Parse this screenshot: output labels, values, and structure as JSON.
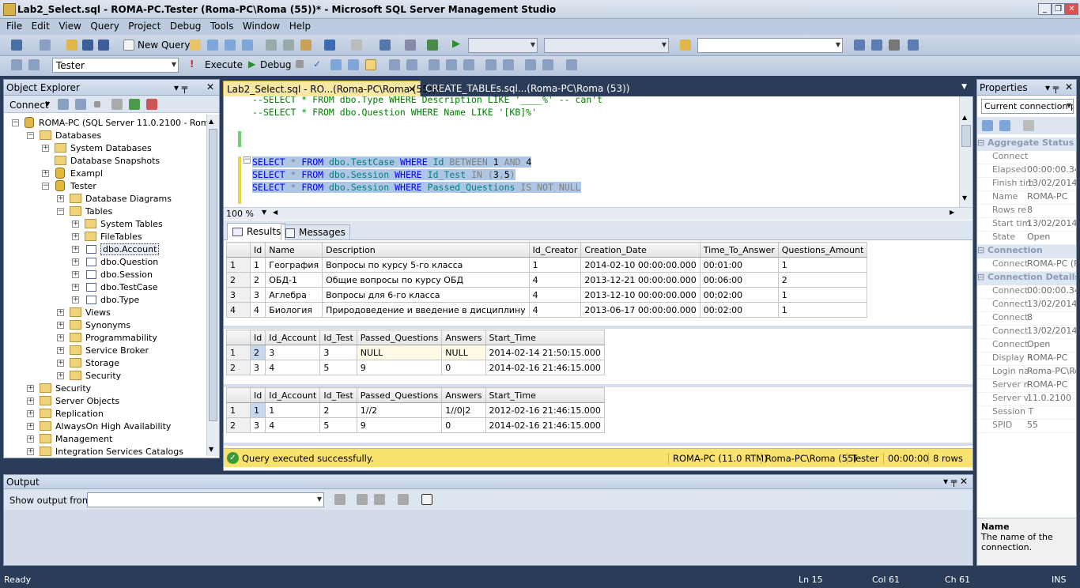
{
  "window": {
    "title": "Lab2_Select.sql - ROMA-PC.Tester (Roma-PC\\Roma (55))* - Microsoft SQL Server Management Studio"
  },
  "menu": [
    "File",
    "Edit",
    "View",
    "Query",
    "Project",
    "Debug",
    "Tools",
    "Window",
    "Help"
  ],
  "toolbar": {
    "new_query": "New Query",
    "database": "Tester",
    "execute": "Execute",
    "debug": "Debug"
  },
  "object_explorer": {
    "title": "Object Explorer",
    "connect": "Connect",
    "nodes": [
      "ROMA-PC (SQL Server 11.0.2100 - Roma-PC\\Roma)",
      "Databases",
      "System Databases",
      "Database Snapshots",
      "Exampl",
      "Tester",
      "Database Diagrams",
      "Tables",
      "System Tables",
      "FileTables",
      "dbo.Account",
      "dbo.Question",
      "dbo.Session",
      "dbo.TestCase",
      "dbo.Type",
      "Views",
      "Synonyms",
      "Programmability",
      "Service Broker",
      "Storage",
      "Security",
      "Security",
      "Server Objects",
      "Replication",
      "AlwaysOn High Availability",
      "Management",
      "Integration Services Catalogs"
    ]
  },
  "tabs": {
    "active": "Lab2_Select.sql - RO...(Roma-PC\\Roma (55))*",
    "other": "CREATE_TABLEs.sql...(Roma-PC\\Roma (53))"
  },
  "editor": {
    "line1": "--SELECT * FROM dbo.Type WHERE Description LIKE '____%' -- can't",
    "line2": "--SELECT * FROM dbo.Question WHERE Name LIKE '[KB]%'",
    "q1": "SELECT * FROM dbo.TestCase WHERE Id BETWEEN 1 AND 4",
    "q2": "SELECT * FROM dbo.Session WHERE Id_Test IN (3,5)",
    "q3": "SELECT * FROM dbo.Session WHERE Passed_Questions IS NOT NULL",
    "zoom": "100 %"
  },
  "results_tabs": {
    "results": "Results",
    "messages": "Messages"
  },
  "grid1": {
    "headers": [
      "Id",
      "Name",
      "Description",
      "Id_Creator",
      "Creation_Date",
      "Time_To_Answer",
      "Questions_Amount"
    ],
    "rows": [
      [
        "1",
        "1",
        "География",
        "Вопросы по курсу 5-го класса",
        "1",
        "2014-02-10 00:00:00.000",
        "00:01:00",
        "1"
      ],
      [
        "2",
        "2",
        "ОБД-1",
        "Общие вопросы по курсу ОБД",
        "4",
        "2013-12-21 00:00:00.000",
        "00:06:00",
        "2"
      ],
      [
        "3",
        "3",
        "Аглебра",
        "Вопросы для 6-го класса",
        "4",
        "2013-12-10 00:00:00.000",
        "00:02:00",
        "1"
      ],
      [
        "4",
        "4",
        "Биология",
        "Природоведение и введение в дисциплину",
        "4",
        "2013-06-17 00:00:00.000",
        "00:02:00",
        "1"
      ]
    ]
  },
  "grid2": {
    "headers": [
      "Id",
      "Id_Account",
      "Id_Test",
      "Passed_Questions",
      "Answers",
      "Start_Time"
    ],
    "rows": [
      [
        "1",
        "2",
        "3",
        "3",
        "NULL",
        "NULL",
        "2014-02-14 21:50:15.000"
      ],
      [
        "2",
        "3",
        "4",
        "5",
        "9",
        "0",
        "2014-02-16 21:46:15.000"
      ]
    ]
  },
  "grid3": {
    "headers": [
      "Id",
      "Id_Account",
      "Id_Test",
      "Passed_Questions",
      "Answers",
      "Start_Time"
    ],
    "rows": [
      [
        "1",
        "1",
        "1",
        "2",
        "1//2",
        "1//0|2",
        "2012-02-16 21:46:15.000"
      ],
      [
        "2",
        "3",
        "4",
        "5",
        "9",
        "0",
        "2014-02-16 21:46:15.000"
      ]
    ]
  },
  "query_status": {
    "message": "Query executed successfully.",
    "server": "ROMA-PC (11.0 RTM)",
    "user": "Roma-PC\\Roma (55)",
    "db": "Tester",
    "time": "00:00:00",
    "rows": "8 rows"
  },
  "properties": {
    "title": "Properties",
    "selector": "Current connection p",
    "cat1": "Aggregate Status",
    "agg": [
      [
        "Connect",
        ""
      ],
      [
        "Elapsed",
        "00:00:00.34"
      ],
      [
        "Finish tim",
        "13/02/2014"
      ],
      [
        "Name",
        "ROMA-PC"
      ],
      [
        "Rows re",
        "8"
      ],
      [
        "Start tim",
        "13/02/2014"
      ],
      [
        "State",
        "Open"
      ]
    ],
    "cat2": "Connection",
    "conn": [
      [
        "Connect",
        "ROMA-PC (R"
      ]
    ],
    "cat3": "Connection Details",
    "details": [
      [
        "Connect",
        "00:00:00.34"
      ],
      [
        "Connect",
        "13/02/2014"
      ],
      [
        "Connect",
        "8"
      ],
      [
        "Connect",
        "13/02/2014"
      ],
      [
        "Connect",
        "Open"
      ],
      [
        "Display n",
        "ROMA-PC"
      ],
      [
        "Login na",
        "Roma-PC\\Ro"
      ],
      [
        "Server n",
        "ROMA-PC"
      ],
      [
        "Server v",
        "11.0.2100"
      ],
      [
        "Session T",
        ""
      ],
      [
        "SPID",
        "55"
      ]
    ],
    "desc_title": "Name",
    "desc_text": "The name of the connection."
  },
  "output": {
    "title": "Output",
    "show_from": "Show output from:"
  },
  "statusbar": {
    "ready": "Ready",
    "ln": "Ln 15",
    "col": "Col 61",
    "ch": "Ch 61",
    "ins": "INS"
  }
}
